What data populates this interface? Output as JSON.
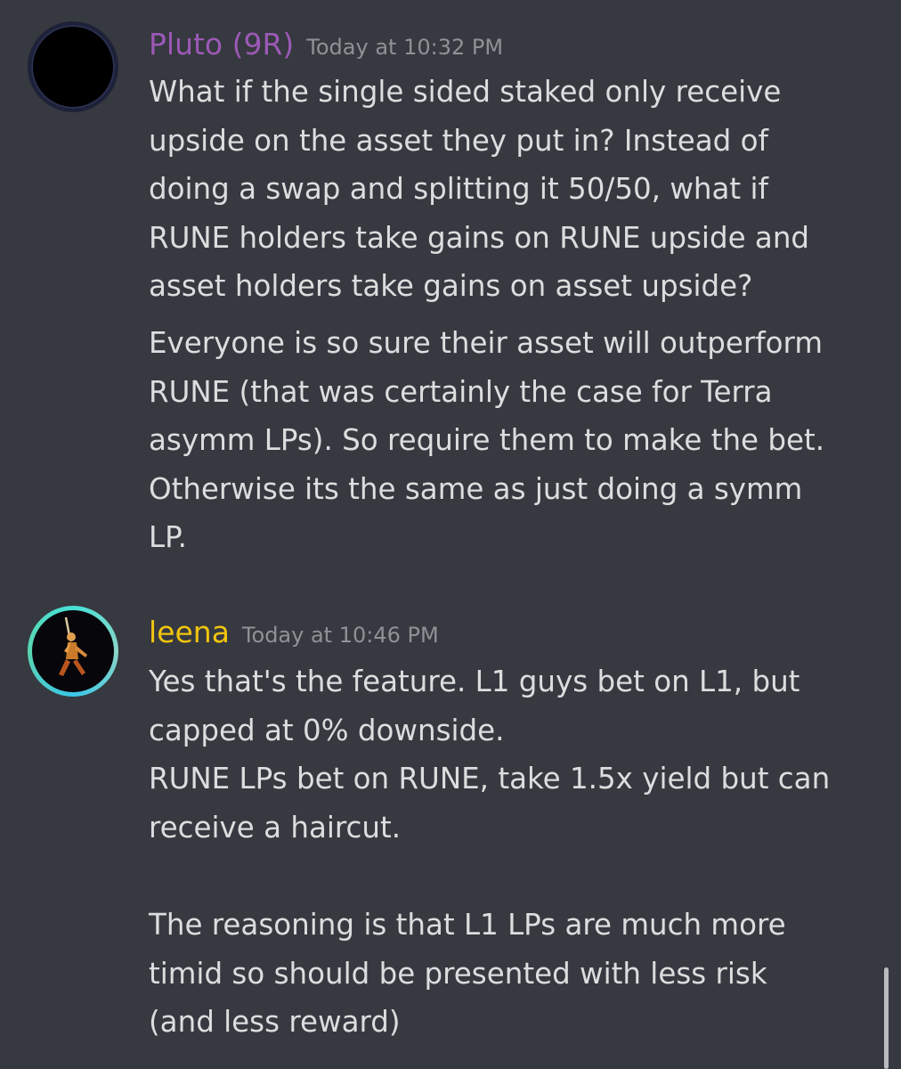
{
  "messages": [
    {
      "username": "Pluto (9R)",
      "username_color": "#9b59b6",
      "timestamp": "Today at 10:32 PM",
      "paragraph1": [
        "What if the single sided staked only receive",
        "upside on the asset they put in? Instead of",
        "doing a swap and splitting it 50/50, what if",
        "RUNE holders take gains on RUNE upside and",
        "asset holders take gains on asset upside?"
      ],
      "paragraph2": [
        "Everyone is so sure their asset will outperform",
        "RUNE (that was certainly the case for Terra",
        "asymm LPs). So require them to make the bet.",
        "Otherwise its the same as just doing a symm",
        "LP."
      ]
    },
    {
      "username": "leena",
      "username_color": "#f1c40f",
      "timestamp": "Today at 10:46 PM",
      "paragraph1": [
        "Yes that's the feature. L1 guys bet on L1, but",
        "capped at 0% downside.",
        "RUNE LPs bet on RUNE, take 1.5x yield but can",
        "receive a haircut."
      ],
      "paragraph2": [
        "The reasoning is that L1 LPs are much more",
        "timid so should be presented with less risk",
        "(and less reward)"
      ]
    }
  ],
  "theme": {
    "background": "#36393f",
    "text": "#dcddde",
    "timestamp": "#8e9297"
  }
}
